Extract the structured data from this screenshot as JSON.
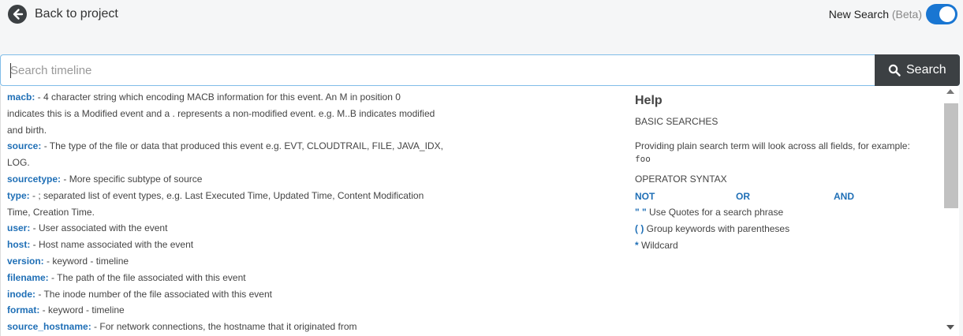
{
  "topbar": {
    "back_label": "Back to project",
    "new_search_label": "New Search",
    "beta_label": "(Beta)",
    "toggle_on": true
  },
  "search": {
    "placeholder": "Search timeline",
    "value": "",
    "button_label": "Search"
  },
  "fields": [
    {
      "key": "macb:",
      "desc": " - 4 character string which encoding MACB information for this event. An M in position 0",
      "cont": [
        "indicates this is a Modified event and a . represents a non-modified event. e.g. M..B indicates modified",
        "and birth."
      ]
    },
    {
      "key": "source:",
      "desc": " - The type of the file or data that produced this event e.g. EVT, CLOUDTRAIL, FILE, JAVA_IDX,",
      "cont": [
        "LOG."
      ]
    },
    {
      "key": "sourcetype:",
      "desc": " - More specific subtype of source",
      "cont": []
    },
    {
      "key": "type:",
      "desc": " - ; separated list of event types, e.g. Last Executed Time, Updated Time, Content Modification",
      "cont": [
        "Time, Creation Time."
      ]
    },
    {
      "key": "user:",
      "desc": " - User associated with the event",
      "cont": []
    },
    {
      "key": "host:",
      "desc": " - Host name associated with the event",
      "cont": []
    },
    {
      "key": "version:",
      "desc": " - keyword - timeline",
      "cont": []
    },
    {
      "key": "filename:",
      "desc": " - The path of the file associated with this event",
      "cont": []
    },
    {
      "key": "inode:",
      "desc": " - The inode number of the file associated with this event",
      "cont": []
    },
    {
      "key": "format:",
      "desc": " - keyword - timeline",
      "cont": []
    },
    {
      "key": "source_hostname:",
      "desc": " - For network connections, the hostname that it originated from",
      "cont": []
    }
  ],
  "help": {
    "title": "Help",
    "basic_heading": "BASIC SEARCHES",
    "basic_text": "Providing plain search term will look across all fields, for example:",
    "basic_example": "foo",
    "operator_heading": "OPERATOR SYNTAX",
    "operators": [
      "NOT",
      "OR",
      "AND"
    ],
    "tips": [
      {
        "sym": "\" \"",
        "text": " Use Quotes for a search phrase"
      },
      {
        "sym": "( )",
        "text": " Group keywords with parentheses"
      },
      {
        "sym": "*",
        "text": " Wildcard"
      }
    ]
  },
  "colors": {
    "accent": "#1976d2",
    "field_key": "#1f6fb6",
    "search_button_bg": "#3c4043"
  }
}
